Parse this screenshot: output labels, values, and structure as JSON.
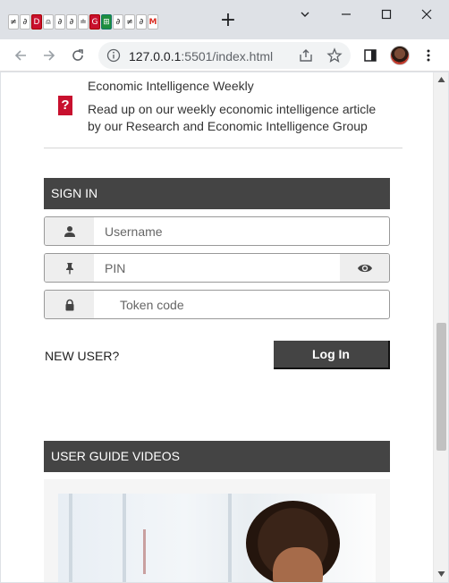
{
  "browser": {
    "favicons": [
      {
        "glyph": "≠",
        "style": "plain"
      },
      {
        "glyph": "∂",
        "style": "plain"
      },
      {
        "glyph": "D",
        "style": "red"
      },
      {
        "glyph": "⍝",
        "style": "plain"
      },
      {
        "glyph": "∂",
        "style": "plain"
      },
      {
        "glyph": "∂",
        "style": "plain"
      },
      {
        "glyph": "≐",
        "style": "plain"
      },
      {
        "glyph": "G",
        "style": "red"
      },
      {
        "glyph": "⊞",
        "style": "green"
      },
      {
        "glyph": "∂",
        "style": "plain"
      },
      {
        "glyph": "≠",
        "style": "plain"
      },
      {
        "glyph": "∂",
        "style": "plain"
      },
      {
        "glyph": "M",
        "style": "gmail"
      }
    ],
    "url_host": "127.0.0.1",
    "url_rest": ":5501/index.html"
  },
  "news": {
    "icon_glyph": "?",
    "title": "Economic Intelligence Weekly",
    "description": "Read up on our weekly economic intelligence article by our Research and Economic Intelligence Group"
  },
  "signin": {
    "header": "SIGN IN",
    "username_placeholder": "Username",
    "pin_placeholder": "PIN",
    "token_placeholder": "Token code",
    "new_user_label": "NEW USER?",
    "login_label": "Log In"
  },
  "guide": {
    "header": "USER GUIDE VIDEOS"
  },
  "colors": {
    "header_bg": "#444444",
    "news_icon": "#c8102e"
  }
}
